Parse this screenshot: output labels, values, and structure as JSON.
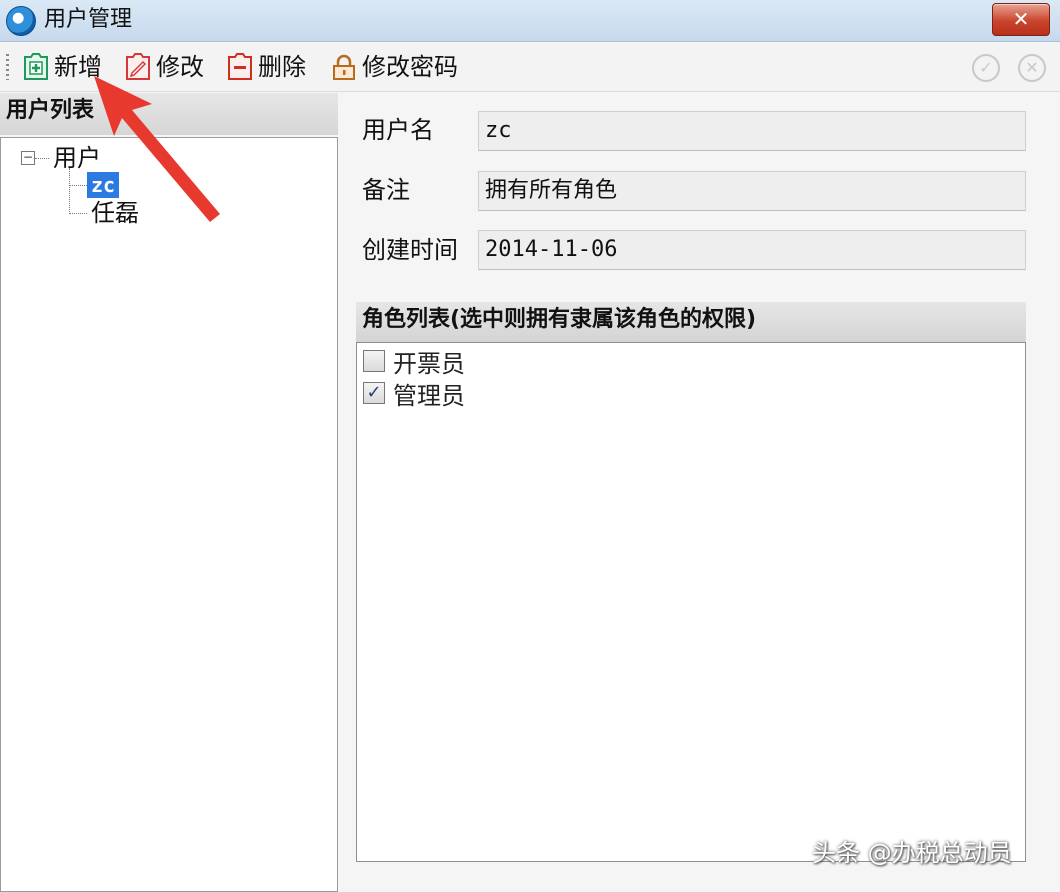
{
  "window": {
    "title": "用户管理",
    "close_symbol": "✕",
    "icon": "app-logo-icon"
  },
  "toolbar": {
    "add_label": "新增",
    "edit_label": "修改",
    "delete_label": "删除",
    "change_password_label": "修改密码",
    "confirm_icon": "check-circle-icon",
    "confirm_symbol": "✓",
    "cancel_icon": "close-circle-icon",
    "cancel_symbol": "✕"
  },
  "user_list": {
    "header": "用户列表",
    "toggle_symbol": "−",
    "root_label": "用户",
    "items": [
      {
        "label": "zc",
        "selected": true
      },
      {
        "label": "任磊",
        "selected": false
      }
    ]
  },
  "details": {
    "username_label": "用户名",
    "username_value": "zc",
    "remark_label": "备注",
    "remark_value": "拥有所有角色",
    "created_label": "创建时间",
    "created_value": "2014-11-06"
  },
  "roles": {
    "header": "角色列表(选中则拥有隶属该角色的权限)",
    "items": [
      {
        "label": "开票员",
        "checked": false
      },
      {
        "label": "管理员",
        "checked": true
      }
    ]
  },
  "annotation": {
    "arrow_color": "#e8392e"
  },
  "watermark": "头条 @办税总动员"
}
